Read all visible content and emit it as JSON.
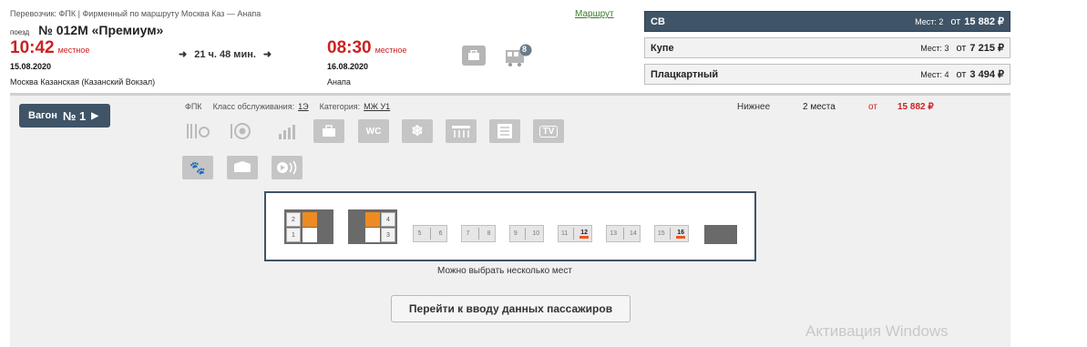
{
  "header": {
    "carrier_line": "Перевозчик: ФПК | Фирменный   по маршруту Москва Каз — Анапа",
    "route_link": "Маршрут",
    "train_prefix": "поезд",
    "train_name": "№ 012М «Премиум»",
    "departure": {
      "time": "10:42",
      "local_label": "местное",
      "date": "15.08.2020",
      "station": "Москва Казанская (Казанский Вокзал)"
    },
    "duration": "21 ч. 48 мин.",
    "arrival": {
      "time": "08:30",
      "local_label": "местное",
      "date": "16.08.2020",
      "station": "Анапа"
    },
    "train_icon_badge": "8"
  },
  "classes": [
    {
      "name": "СВ",
      "seats": "Мест: 2",
      "from": "от",
      "price": "15 882 ₽",
      "active": true
    },
    {
      "name": "Купе",
      "seats": "Мест: 3",
      "from": "от",
      "price": "7 215 ₽",
      "active": false
    },
    {
      "name": "Плацкартный",
      "seats": "Мест: 4",
      "from": "от",
      "price": "3 494 ₽",
      "active": false
    }
  ],
  "wagon": {
    "button_label": "Вагон",
    "number": "№ 1",
    "carrier": "ФПК",
    "service_class_label": "Класс обслуживания:",
    "service_class": "1Э",
    "category_label": "Категория:",
    "category": "МЖ У1",
    "lower_label": "Нижнее",
    "lower_count": "2 места",
    "lower_from": "от",
    "lower_price": "15 882 ₽",
    "services": [
      "food-icon",
      "restaurant-icon",
      "chart-icon",
      "bag-icon",
      "wc-icon",
      "snowflake-icon",
      "shower-icon",
      "newspaper-icon",
      "tv-icon",
      "pet-icon",
      "blanket-icon",
      "audio-icon"
    ],
    "wc_label": "WC",
    "tv_label": "TV"
  },
  "car_map": {
    "comp1": {
      "top": "2",
      "bottom": "1"
    },
    "comp2": {
      "top": "4",
      "bottom": "3"
    },
    "small": [
      {
        "a": "5",
        "b": "6"
      },
      {
        "a": "7",
        "b": "8"
      },
      {
        "a": "9",
        "b": "10"
      },
      {
        "a": "11",
        "b": "12"
      },
      {
        "a": "13",
        "b": "14"
      },
      {
        "a": "15",
        "b": "16"
      }
    ],
    "hint": "Можно выбрать несколько мест"
  },
  "continue_button": "Перейти к вводу данных пассажиров",
  "watermark": "Активация Windows",
  "colors": {
    "accent": "#3f5466",
    "red": "#cc2222",
    "orange": "#ee8a22"
  }
}
